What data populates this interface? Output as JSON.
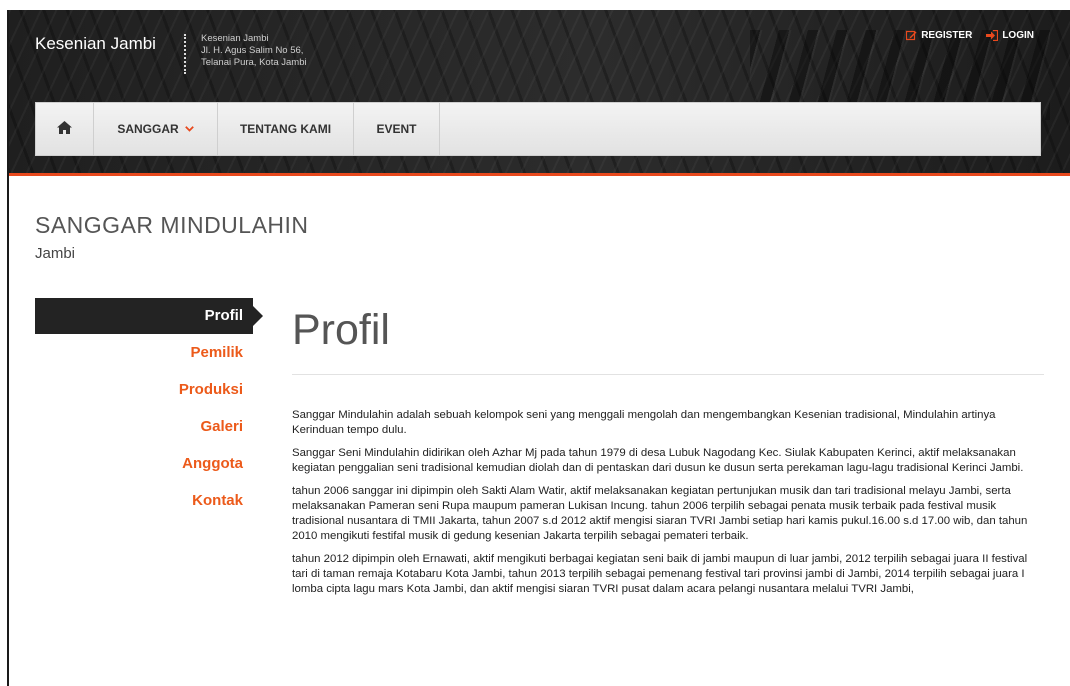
{
  "header": {
    "brand": "Kesenian Jambi",
    "address": [
      "Kesenian Jambi",
      "Jl. H. Agus Salim No 56,",
      "Telanai Pura, Kota Jambi"
    ],
    "links": {
      "register": "REGISTER",
      "login": "LOGIN"
    },
    "accent_color": "#e8491d"
  },
  "nav": {
    "home_icon": "home-icon",
    "items": {
      "sanggar": "SANGGAR",
      "tentang": "TENTANG KAMI",
      "event": "EVENT"
    }
  },
  "page": {
    "title": "SANGGAR MINDULAHIN",
    "subtitle": "Jambi"
  },
  "sidebar": {
    "items": [
      "Profil",
      "Pemilik",
      "Produksi",
      "Galeri",
      "Anggota",
      "Kontak"
    ],
    "active": "Profil"
  },
  "content": {
    "heading": "Profil",
    "paragraphs": [
      "Sanggar Mindulahin adalah sebuah kelompok seni yang menggali mengolah dan mengembangkan Kesenian tradisional, Mindulahin artinya Kerinduan tempo dulu.",
      "Sanggar Seni Mindulahin didirikan oleh Azhar Mj pada tahun 1979 di desa Lubuk Nagodang Kec. Siulak Kabupaten Kerinci, aktif melaksanakan kegiatan penggalian seni tradisional kemudian diolah dan di pentaskan dari dusun ke dusun serta perekaman lagu-lagu tradisional Kerinci Jambi.",
      "tahun 2006 sanggar ini dipimpin oleh Sakti Alam Watir, aktif melaksanakan kegiatan pertunjukan musik dan tari tradisional melayu Jambi, serta melaksanakan Pameran seni Rupa maupum pameran Lukisan Incung. tahun 2006 terpilih sebagai penata musik terbaik pada festival musik tradisional nusantara di TMII Jakarta, tahun 2007 s.d 2012 aktif mengisi siaran TVRI Jambi setiap hari kamis pukul.16.00 s.d 17.00 wib, dan tahun 2010 mengikuti festifal musik di gedung kesenian Jakarta terpilih sebagai pemateri terbaik.",
      "tahun 2012 dipimpin oleh Ernawati, aktif mengikuti berbagai kegiatan seni baik di jambi maupun di luar jambi, 2012 terpilih sebagai juara II festival tari di taman remaja Kotabaru Kota Jambi, tahun 2013 terpilih sebagai pemenang festival tari provinsi jambi di Jambi, 2014 terpilih sebagai juara I lomba cipta lagu mars Kota Jambi, dan aktif mengisi siaran TVRI pusat dalam acara pelangi nusantara melalui TVRI Jambi,"
    ]
  }
}
